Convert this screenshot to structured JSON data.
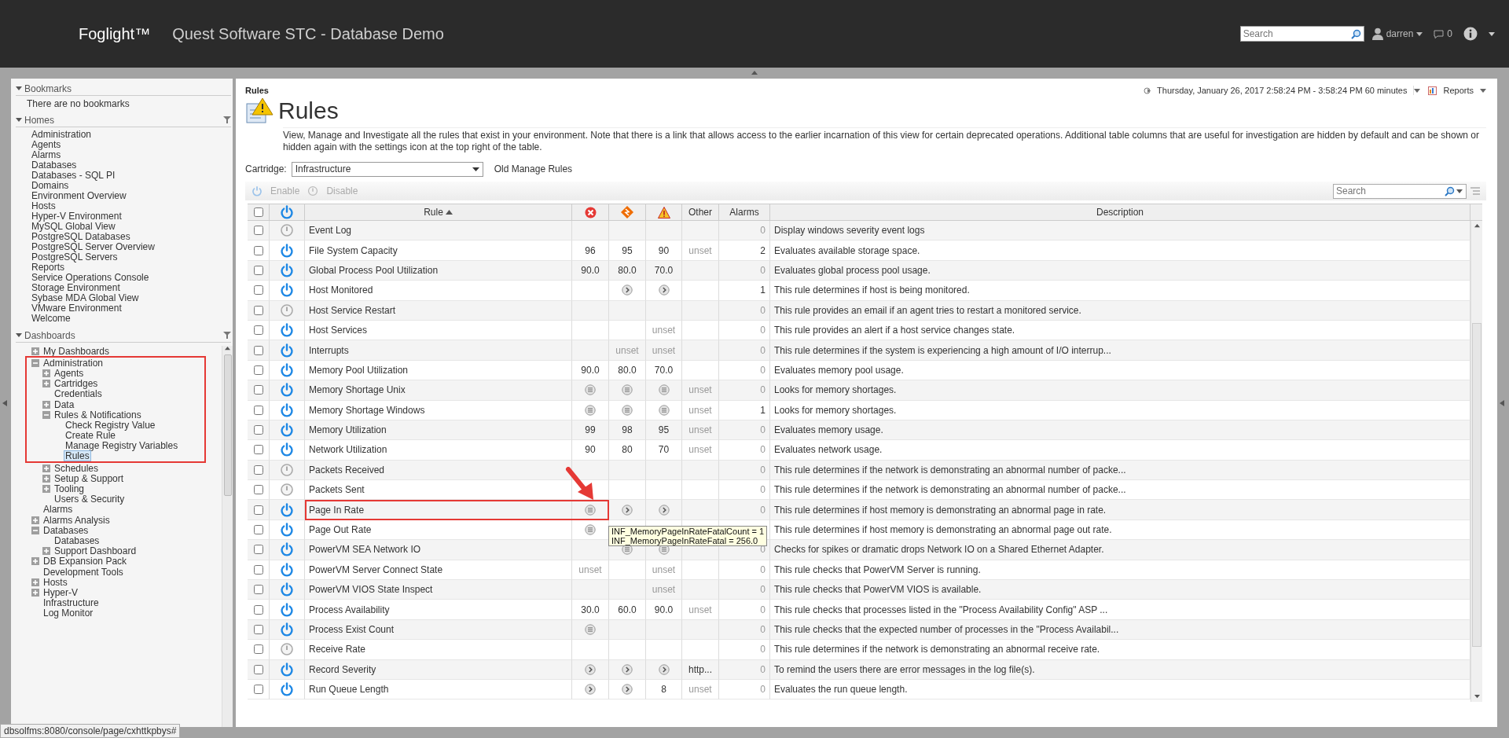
{
  "header": {
    "product": "Foglight™",
    "title": "Quest Software STC - Database Demo",
    "search": {
      "placeholder": "Search"
    },
    "user": "darren",
    "messages": "0"
  },
  "sidebar": {
    "bookmarks": {
      "title": "Bookmarks",
      "empty_text": "There are no bookmarks"
    },
    "homes": {
      "title": "Homes",
      "items": [
        "Administration",
        "Agents",
        "Alarms",
        "Databases",
        "Databases - SQL PI",
        "Domains",
        "Environment Overview",
        "Hosts",
        "Hyper-V Environment",
        "MySQL Global View",
        "PostgreSQL Databases",
        "PostgreSQL Server Overview",
        "PostgreSQL Servers",
        "Reports",
        "Service Operations Console",
        "Storage Environment",
        "Sybase MDA Global View",
        "VMware Environment",
        "Welcome"
      ]
    },
    "dashboards": {
      "title": "Dashboards",
      "tree": [
        {
          "label": "My Dashboards",
          "expanded": false,
          "selected": false
        },
        {
          "label": "Administration",
          "expanded": true,
          "selected": false,
          "annotated": true,
          "children": [
            {
              "label": "Agents",
              "expanded": false,
              "selected": false
            },
            {
              "label": "Cartridges",
              "expanded": false,
              "selected": false
            },
            {
              "label": "Credentials",
              "selected": false
            },
            {
              "label": "Data",
              "expanded": false,
              "selected": false
            },
            {
              "label": "Rules & Notifications",
              "expanded": true,
              "selected": false,
              "children": [
                {
                  "label": "Check Registry Value",
                  "selected": false
                },
                {
                  "label": "Create Rule",
                  "selected": false
                },
                {
                  "label": "Manage Registry Variables",
                  "selected": false
                },
                {
                  "label": "Rules",
                  "selected": true,
                  "annotated": true
                }
              ]
            },
            {
              "label": "Schedules",
              "expanded": false,
              "selected": false
            },
            {
              "label": "Setup & Support",
              "expanded": false,
              "selected": false
            },
            {
              "label": "Tooling",
              "expanded": false,
              "selected": false
            },
            {
              "label": "Users & Security",
              "selected": false
            }
          ]
        },
        {
          "label": "Alarms",
          "selected": false
        },
        {
          "label": "Alarms Analysis",
          "expanded": false,
          "selected": false
        },
        {
          "label": "Databases",
          "expanded": true,
          "selected": false,
          "children": [
            {
              "label": "Databases",
              "selected": false
            },
            {
              "label": "Support Dashboard",
              "expanded": false,
              "selected": false
            }
          ]
        },
        {
          "label": "DB Expansion Pack",
          "expanded": false,
          "selected": false
        },
        {
          "label": "Development Tools",
          "selected": false
        },
        {
          "label": "Hosts",
          "expanded": false,
          "selected": false
        },
        {
          "label": "Hyper-V",
          "expanded": false,
          "selected": false
        },
        {
          "label": "Infrastructure",
          "selected": false
        },
        {
          "label": "Log Monitor",
          "selected": false
        }
      ]
    }
  },
  "main": {
    "breadcrumb": "Rules",
    "time_range": "Thursday, January 26, 2017 2:58:24 PM - 3:58:24 PM 60 minutes",
    "reports": "Reports",
    "title": "Rules",
    "description": "View, Manage and Investigate all the rules that exist in your environment. Note that there is a link that allows access to the earlier incarnation of this view for certain deprecated operations. Additional table columns that are useful for investigation are hidden by default and can be shown or hidden again with the settings icon at the top right of the table.",
    "cartridge": {
      "label": "Cartridge:",
      "value": "Infrastructure"
    },
    "old_link": "Old Manage Rules",
    "toolbar": {
      "enable": "Enable",
      "disable": "Disable",
      "search": {
        "placeholder": "Search"
      }
    },
    "table": {
      "select_all_checked": false,
      "columns": {
        "rule": "Rule",
        "other": "Other",
        "alarms": "Alarms",
        "description": "Description"
      },
      "rows": [
        {
          "checked": false,
          "enabled": false,
          "name": "Event Log",
          "cells": [
            {
              "kind": "empty"
            },
            {
              "kind": "empty"
            },
            {
              "kind": "empty"
            },
            {
              "kind": "empty"
            }
          ],
          "alarms": {
            "kind": "muted",
            "text": "0"
          },
          "description": "Display windows severity event logs"
        },
        {
          "checked": false,
          "enabled": true,
          "name": "File System Capacity",
          "cells": [
            {
              "kind": "text",
              "text": "96"
            },
            {
              "kind": "text",
              "text": "95"
            },
            {
              "kind": "text",
              "text": "90"
            },
            {
              "kind": "muted",
              "text": "unset"
            }
          ],
          "alarms": {
            "kind": "text",
            "text": "2"
          },
          "description": "Evaluates available storage space."
        },
        {
          "checked": false,
          "enabled": true,
          "name": "Global Process Pool Utilization",
          "cells": [
            {
              "kind": "text",
              "text": "90.0"
            },
            {
              "kind": "text",
              "text": "80.0"
            },
            {
              "kind": "text",
              "text": "70.0"
            },
            {
              "kind": "empty"
            }
          ],
          "alarms": {
            "kind": "muted",
            "text": "0"
          },
          "description": "Evaluates global process pool usage."
        },
        {
          "checked": false,
          "enabled": true,
          "name": "Host Monitored",
          "cells": [
            {
              "kind": "empty"
            },
            {
              "kind": "arrow"
            },
            {
              "kind": "arrow"
            },
            {
              "kind": "empty"
            }
          ],
          "alarms": {
            "kind": "text",
            "text": "1"
          },
          "description": "This rule determines if host is being monitored."
        },
        {
          "checked": false,
          "enabled": false,
          "name": "Host Service Restart",
          "cells": [
            {
              "kind": "empty"
            },
            {
              "kind": "empty"
            },
            {
              "kind": "empty"
            },
            {
              "kind": "empty"
            }
          ],
          "alarms": {
            "kind": "muted",
            "text": "0"
          },
          "description": "This rule provides an email if an agent tries to restart a monitored service."
        },
        {
          "checked": false,
          "enabled": true,
          "name": "Host Services",
          "cells": [
            {
              "kind": "empty"
            },
            {
              "kind": "empty"
            },
            {
              "kind": "muted",
              "text": "unset"
            },
            {
              "kind": "empty"
            }
          ],
          "alarms": {
            "kind": "muted",
            "text": "0"
          },
          "description": "This rule provides an alert if a host service changes state."
        },
        {
          "checked": false,
          "enabled": true,
          "name": "Interrupts",
          "cells": [
            {
              "kind": "empty"
            },
            {
              "kind": "muted",
              "text": "unset"
            },
            {
              "kind": "muted",
              "text": "unset"
            },
            {
              "kind": "empty"
            }
          ],
          "alarms": {
            "kind": "muted",
            "text": "0"
          },
          "description": "This rule determines if the system is experiencing a high amount of I/O interrup..."
        },
        {
          "checked": false,
          "enabled": true,
          "name": "Memory Pool Utilization",
          "cells": [
            {
              "kind": "text",
              "text": "90.0"
            },
            {
              "kind": "text",
              "text": "80.0"
            },
            {
              "kind": "text",
              "text": "70.0"
            },
            {
              "kind": "empty"
            }
          ],
          "alarms": {
            "kind": "muted",
            "text": "0"
          },
          "description": "Evaluates memory pool usage."
        },
        {
          "checked": false,
          "enabled": true,
          "name": "Memory Shortage Unix",
          "cells": [
            {
              "kind": "list"
            },
            {
              "kind": "list"
            },
            {
              "kind": "list"
            },
            {
              "kind": "muted",
              "text": "unset"
            }
          ],
          "alarms": {
            "kind": "muted",
            "text": "0"
          },
          "description": "Looks for memory shortages."
        },
        {
          "checked": false,
          "enabled": true,
          "name": "Memory Shortage Windows",
          "cells": [
            {
              "kind": "list"
            },
            {
              "kind": "list"
            },
            {
              "kind": "list"
            },
            {
              "kind": "muted",
              "text": "unset"
            }
          ],
          "alarms": {
            "kind": "text",
            "text": "1"
          },
          "description": "Looks for memory shortages."
        },
        {
          "checked": false,
          "enabled": true,
          "name": "Memory Utilization",
          "cells": [
            {
              "kind": "text",
              "text": "99"
            },
            {
              "kind": "text",
              "text": "98"
            },
            {
              "kind": "text",
              "text": "95"
            },
            {
              "kind": "muted",
              "text": "unset"
            }
          ],
          "alarms": {
            "kind": "muted",
            "text": "0"
          },
          "description": "Evaluates memory usage."
        },
        {
          "checked": false,
          "enabled": true,
          "name": "Network Utilization",
          "cells": [
            {
              "kind": "text",
              "text": "90"
            },
            {
              "kind": "text",
              "text": "80"
            },
            {
              "kind": "text",
              "text": "70"
            },
            {
              "kind": "muted",
              "text": "unset"
            }
          ],
          "alarms": {
            "kind": "muted",
            "text": "0"
          },
          "description": "Evaluates network usage."
        },
        {
          "checked": false,
          "enabled": false,
          "name": "Packets Received",
          "cells": [
            {
              "kind": "empty"
            },
            {
              "kind": "empty"
            },
            {
              "kind": "empty"
            },
            {
              "kind": "empty"
            }
          ],
          "alarms": {
            "kind": "muted",
            "text": "0"
          },
          "description": "This rule determines if the network is demonstrating an abnormal number of packe..."
        },
        {
          "checked": false,
          "enabled": false,
          "name": "Packets Sent",
          "cells": [
            {
              "kind": "empty"
            },
            {
              "kind": "empty"
            },
            {
              "kind": "empty"
            },
            {
              "kind": "empty"
            }
          ],
          "alarms": {
            "kind": "muted",
            "text": "0"
          },
          "description": "This rule determines if the network is demonstrating an abnormal number of packe..."
        },
        {
          "checked": false,
          "enabled": true,
          "name": "Page In Rate",
          "annotated": true,
          "tooltip": [
            "INF_MemoryPageInRateFatalCount = 1",
            "INF_MemoryPageInRateFatal = 256.0"
          ],
          "cells": [
            {
              "kind": "list"
            },
            {
              "kind": "arrow"
            },
            {
              "kind": "arrow"
            },
            {
              "kind": "empty"
            }
          ],
          "alarms": {
            "kind": "muted",
            "text": "0"
          },
          "description": "This rule determines if host memory is demonstrating an abnormal page in rate."
        },
        {
          "checked": false,
          "enabled": true,
          "name": "Page Out Rate",
          "cells": [
            {
              "kind": "list"
            },
            {
              "kind": "empty"
            },
            {
              "kind": "empty"
            },
            {
              "kind": "empty"
            }
          ],
          "alarms": {
            "kind": "empty"
          },
          "description": "This rule determines if host memory is demonstrating an abnormal page out rate."
        },
        {
          "checked": false,
          "enabled": true,
          "name": "PowerVM SEA Network IO",
          "cells": [
            {
              "kind": "empty"
            },
            {
              "kind": "list"
            },
            {
              "kind": "list"
            },
            {
              "kind": "empty"
            }
          ],
          "alarms": {
            "kind": "muted",
            "text": "0"
          },
          "description": "Checks for spikes or dramatic drops Network IO on a Shared Ethernet Adapter."
        },
        {
          "checked": false,
          "enabled": true,
          "name": "PowerVM Server Connect State",
          "cells": [
            {
              "kind": "muted",
              "text": "unset"
            },
            {
              "kind": "empty"
            },
            {
              "kind": "muted",
              "text": "unset"
            },
            {
              "kind": "empty"
            }
          ],
          "alarms": {
            "kind": "muted",
            "text": "0"
          },
          "description": "This rule checks that PowerVM Server is running."
        },
        {
          "checked": false,
          "enabled": true,
          "name": "PowerVM VIOS State Inspect",
          "cells": [
            {
              "kind": "empty"
            },
            {
              "kind": "empty"
            },
            {
              "kind": "muted",
              "text": "unset"
            },
            {
              "kind": "empty"
            }
          ],
          "alarms": {
            "kind": "muted",
            "text": "0"
          },
          "description": "This rule checks that PowerVM VIOS is available."
        },
        {
          "checked": false,
          "enabled": true,
          "name": "Process Availability",
          "cells": [
            {
              "kind": "text",
              "text": "30.0"
            },
            {
              "kind": "text",
              "text": "60.0"
            },
            {
              "kind": "text",
              "text": "90.0"
            },
            {
              "kind": "muted",
              "text": "unset"
            }
          ],
          "alarms": {
            "kind": "muted",
            "text": "0"
          },
          "description": "This rule checks that processes listed in the \"Process Availability Config\" ASP ..."
        },
        {
          "checked": false,
          "enabled": true,
          "name": "Process Exist Count",
          "cells": [
            {
              "kind": "list"
            },
            {
              "kind": "empty"
            },
            {
              "kind": "empty"
            },
            {
              "kind": "empty"
            }
          ],
          "alarms": {
            "kind": "muted",
            "text": "0"
          },
          "description": "This rule checks that the expected number of processes in the \"Process Availabil..."
        },
        {
          "checked": false,
          "enabled": false,
          "name": "Receive Rate",
          "cells": [
            {
              "kind": "empty"
            },
            {
              "kind": "empty"
            },
            {
              "kind": "empty"
            },
            {
              "kind": "empty"
            }
          ],
          "alarms": {
            "kind": "muted",
            "text": "0"
          },
          "description": "This rule determines if the network is demonstrating an abnormal receive rate."
        },
        {
          "checked": false,
          "enabled": true,
          "name": "Record Severity",
          "cells": [
            {
              "kind": "arrow"
            },
            {
              "kind": "arrow"
            },
            {
              "kind": "arrow"
            },
            {
              "kind": "text",
              "text": "http..."
            }
          ],
          "alarms": {
            "kind": "muted",
            "text": "0"
          },
          "description": "To remind the users there are error messages in the log file(s)."
        },
        {
          "checked": false,
          "enabled": true,
          "name": "Run Queue Length",
          "cells": [
            {
              "kind": "arrow"
            },
            {
              "kind": "arrow"
            },
            {
              "kind": "text",
              "text": "8"
            },
            {
              "kind": "muted",
              "text": "unset"
            }
          ],
          "alarms": {
            "kind": "muted",
            "text": "0"
          },
          "description": "Evaluates the run queue length."
        }
      ]
    }
  },
  "status_url": "dbsolfms:8080/console/page/cxhttkpbys#"
}
